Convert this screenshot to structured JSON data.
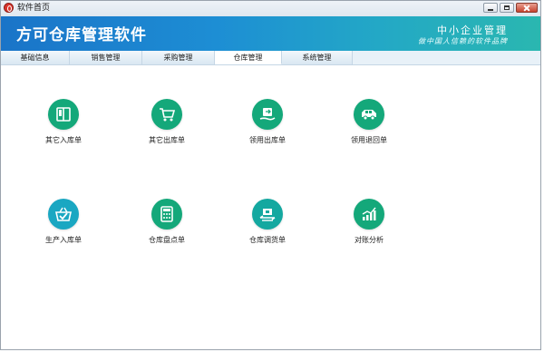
{
  "window": {
    "title": "软件首页"
  },
  "banner": {
    "app_name": "方可仓库管理软件",
    "slogan_main": "中小企业管理",
    "slogan_sub": "做中国人信赖的软件品牌"
  },
  "tabs": [
    {
      "label": "基础信息",
      "active": false
    },
    {
      "label": "销售管理",
      "active": false
    },
    {
      "label": "采购管理",
      "active": false
    },
    {
      "label": "仓库管理",
      "active": true
    },
    {
      "label": "系统管理",
      "active": false
    }
  ],
  "tiles": [
    {
      "label": "其它入库单",
      "icon": "book-icon",
      "color": "#14a87a"
    },
    {
      "label": "其它出库单",
      "icon": "cart-icon",
      "color": "#14a87a"
    },
    {
      "label": "领用出库单",
      "icon": "handover-icon",
      "color": "#14a87a"
    },
    {
      "label": "领用退回单",
      "icon": "van-icon",
      "color": "#14a87a"
    },
    {
      "label": "生产入库单",
      "icon": "basket-check-icon",
      "color": "#1aa7c2"
    },
    {
      "label": "仓库盘点单",
      "icon": "calculator-icon",
      "color": "#14a87a"
    },
    {
      "label": "仓库调货单",
      "icon": "transfer-icon",
      "color": "#14a8a0"
    },
    {
      "label": "对账分析",
      "icon": "growth-chart-icon",
      "color": "#14a87a"
    }
  ]
}
